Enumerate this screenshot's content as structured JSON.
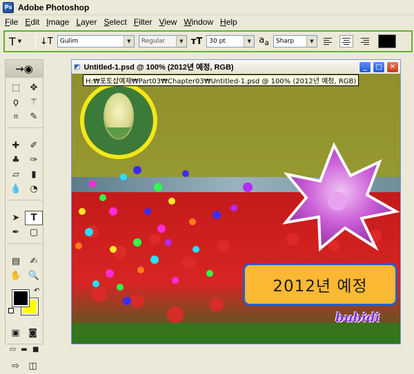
{
  "app": {
    "title": "Adobe Photoshop",
    "logo": "Ps"
  },
  "menu": [
    "File",
    "Edit",
    "Image",
    "Layer",
    "Select",
    "Filter",
    "View",
    "Window",
    "Help"
  ],
  "options": {
    "tool_glyph": "T",
    "font_family": "Gulim",
    "font_style": "Regular",
    "font_size": "30 pt",
    "aa_label": "a",
    "antialias": "Sharp",
    "text_color": "#000000"
  },
  "toolbox": {
    "foreground": "#000000",
    "background": "#ffff00"
  },
  "document": {
    "title": "Untitled-1.psd @ 100% (2012년 예정, RGB)",
    "path_tooltip": "H:₩포토샵예제₩Part03₩Chapter03₩Untitled-1.psd @ 100% (2012년 예정, RGB)",
    "caption": "2012년 예정",
    "signature": "bubidi"
  },
  "colors": {
    "options_border": "#5cb52d",
    "caption_fill": "#ffc636",
    "caption_border": "#1e62d0"
  }
}
